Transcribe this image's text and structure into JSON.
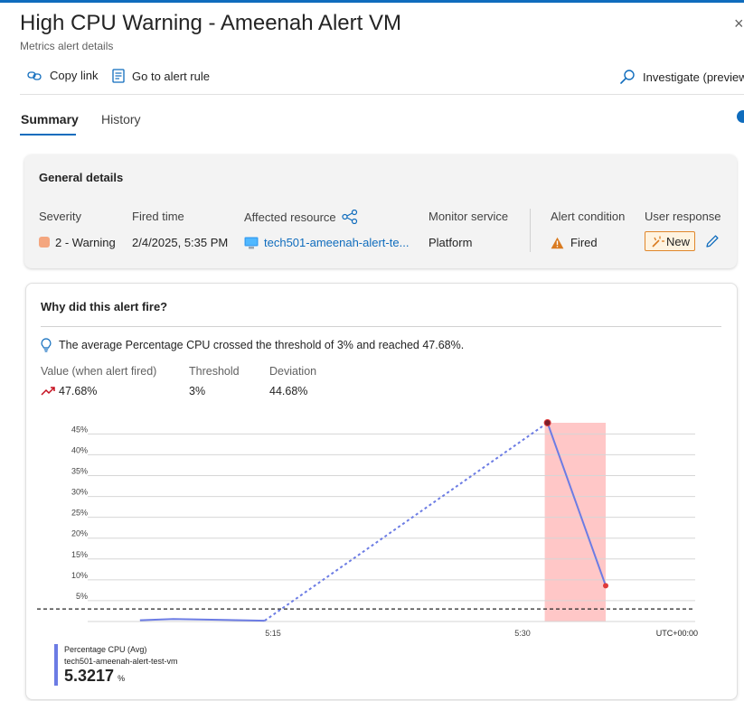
{
  "header": {
    "title": "High CPU Warning - Ameenah Alert VM",
    "subtitle": "Metrics alert details",
    "close_glyph": "×"
  },
  "toolbar": {
    "copy_link": "Copy link",
    "go_to_rule": "Go to alert rule",
    "investigate": "Investigate (preview"
  },
  "tabs": [
    {
      "label": "Summary",
      "active": true
    },
    {
      "label": "History",
      "active": false
    }
  ],
  "general": {
    "title": "General details",
    "columns": {
      "severity": {
        "label": "Severity",
        "value": "2 - Warning"
      },
      "fired_time": {
        "label": "Fired time",
        "value": "2/4/2025, 5:35 PM"
      },
      "affected_resource": {
        "label": "Affected resource",
        "value": "tech501-ameenah-alert-te..."
      },
      "monitor_service": {
        "label": "Monitor service",
        "value": "Platform"
      },
      "alert_condition": {
        "label": "Alert condition",
        "value": "Fired"
      },
      "user_response": {
        "label": "User response",
        "value": "New"
      }
    }
  },
  "why": {
    "title": "Why did this alert fire?",
    "message": "The average Percentage CPU crossed the threshold of 3% and reached 47.68%.",
    "stats": {
      "value": {
        "label": "Value (when alert fired)",
        "value": "47.68%"
      },
      "threshold": {
        "label": "Threshold",
        "value": "3%"
      },
      "deviation": {
        "label": "Deviation",
        "value": "44.68%"
      }
    }
  },
  "chart_data": {
    "type": "line",
    "y_ticks": [
      "5%",
      "10%",
      "15%",
      "20%",
      "25%",
      "30%",
      "35%",
      "40%",
      "45%"
    ],
    "x_ticks": [
      "5:15",
      "5:30"
    ],
    "timezone": "UTC+00:00",
    "ylim": [
      0,
      47.68
    ],
    "threshold": 3,
    "series": [
      {
        "name": "Percentage CPU (Avg)",
        "resource": "tech501-ameenah-alert-test-vm",
        "points": [
          {
            "t": "5:07",
            "y": 0.3
          },
          {
            "t": "5:09",
            "y": 0.6
          },
          {
            "t": "5:14.5",
            "y": 0.2
          },
          {
            "t": "5:31.5",
            "y": 47.68
          },
          {
            "t": "5:35",
            "y": 8.6
          }
        ],
        "latest_value": "5.3217",
        "unit": "%"
      }
    ],
    "colors": {
      "line": "#6c7ce4",
      "highlight": "#ffc7c7",
      "threshold": "#242424"
    }
  }
}
